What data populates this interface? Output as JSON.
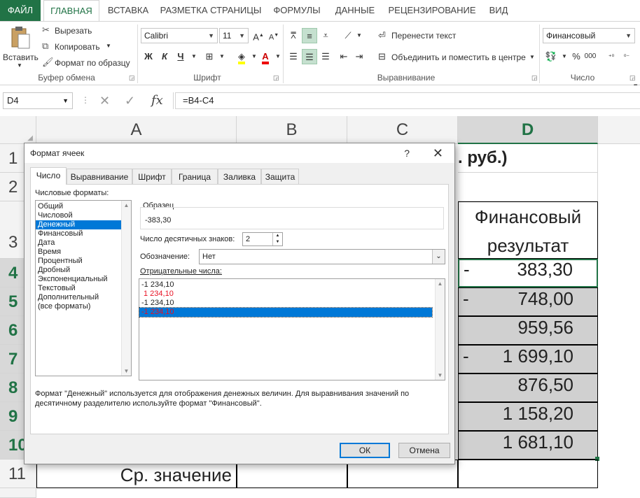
{
  "ribbon_tabs": [
    "ФАЙЛ",
    "ГЛАВНАЯ",
    "ВСТАВКА",
    "РАЗМЕТКА СТРАНИЦЫ",
    "ФОРМУЛЫ",
    "ДАННЫЕ",
    "РЕЦЕНЗИРОВАНИЕ",
    "ВИД"
  ],
  "clipboard": {
    "paste": "Вставить",
    "cut": "Вырезать",
    "copy": "Копировать",
    "format_painter": "Формат по образцу",
    "group": "Буфер обмена"
  },
  "font": {
    "name": "Calibri",
    "size": "11",
    "bold": "Ж",
    "italic": "К",
    "underline": "Ч",
    "group": "Шрифт"
  },
  "alignment": {
    "wrap": "Перенести текст",
    "merge": "Объединить и поместить в центре",
    "group": "Выравнивание"
  },
  "number": {
    "format": "Финансовый",
    "percent": "%",
    "thousands": "000",
    "group": "Число"
  },
  "formula_bar": {
    "name_box": "D4",
    "formula": "=B4-C4"
  },
  "columns": [
    "A",
    "B",
    "C",
    "D"
  ],
  "rows": [
    "1",
    "2",
    "3",
    "4",
    "5",
    "6",
    "7",
    "8",
    "9",
    "10",
    "11"
  ],
  "cells": {
    "d1_fragment": ". руб.)",
    "d3_line1": "Финансовый",
    "d3_line2": "результат",
    "a11": "Ср. значение",
    "d_values": [
      {
        "dash": "-",
        "value": "383,30"
      },
      {
        "dash": "-",
        "value": "748,00"
      },
      {
        "dash": "",
        "value": "959,56"
      },
      {
        "dash": "-",
        "value": "1 699,10"
      },
      {
        "dash": "",
        "value": "876,50"
      },
      {
        "dash": "",
        "value": "1 158,20"
      },
      {
        "dash": "",
        "value": "1 681,10"
      }
    ]
  },
  "dialog": {
    "title": "Формат ячеек",
    "help": "?",
    "tabs": [
      "Число",
      "Выравнивание",
      "Шрифт",
      "Граница",
      "Заливка",
      "Защита"
    ],
    "formats_label": "Числовые форматы:",
    "formats": [
      "Общий",
      "Числовой",
      "Денежный",
      "Финансовый",
      "Дата",
      "Время",
      "Процентный",
      "Дробный",
      "Экспоненциальный",
      "Текстовый",
      "Дополнительный",
      "(все форматы)"
    ],
    "selected_format": "Денежный",
    "sample_label": "Образец",
    "sample_value": "-383,30",
    "decimals_label": "Число десятичных знаков:",
    "decimals_value": "2",
    "symbol_label": "Обозначение:",
    "symbol_value": "Нет",
    "negative_label": "Отрицательные числа:",
    "negative_options": [
      {
        "text": "-1 234,10",
        "red": false,
        "selected": false
      },
      {
        "text": "1 234,10",
        "red": true,
        "selected": false
      },
      {
        "text": "-1 234,10",
        "red": false,
        "selected": false
      },
      {
        "text": "-1 234,10",
        "red": true,
        "selected": true
      }
    ],
    "description": "Формат \"Денежный\" используется для отображения денежных величин. Для выравнивания значений по десятичному разделителю используйте формат \"Финансовый\".",
    "ok": "ОК",
    "cancel": "Отмена"
  },
  "colors": {
    "excel_green": "#217346",
    "selection_blue": "#0078d7",
    "negative_red": "#e81123",
    "cell_shade": "#d0d0d0"
  }
}
